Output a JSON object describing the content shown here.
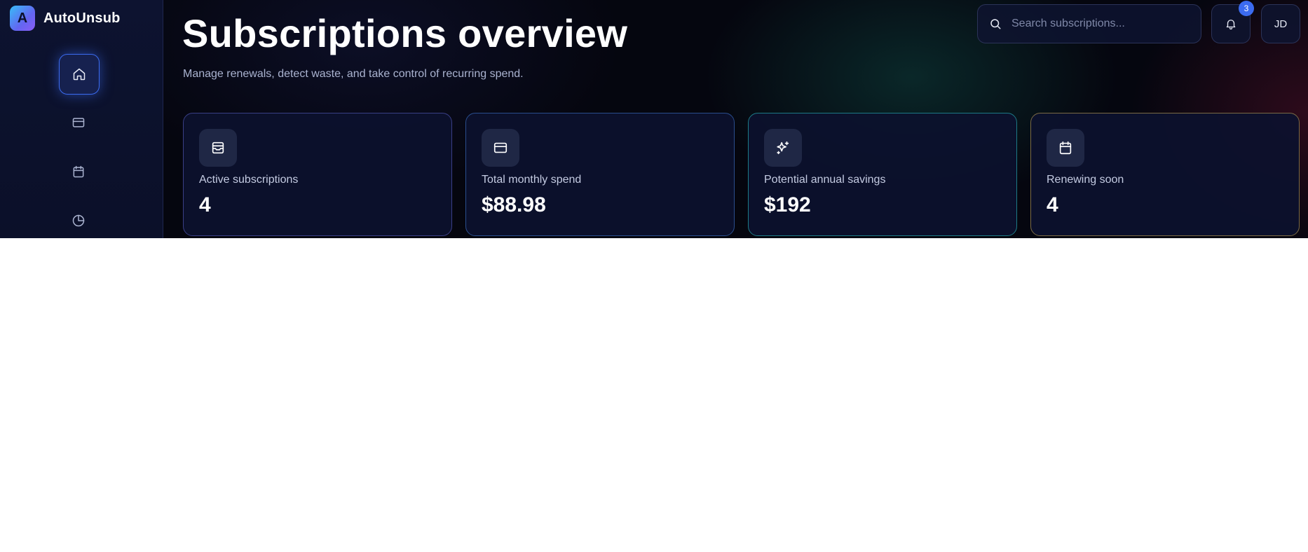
{
  "app": {
    "logo_letter": "A",
    "name": "AutoUnsub"
  },
  "sidebar": {
    "items": [
      {
        "icon": "home-icon",
        "active": true
      },
      {
        "icon": "credit-card-icon",
        "active": false
      },
      {
        "icon": "calendar-icon",
        "active": false
      },
      {
        "icon": "pie-chart-icon",
        "active": false
      }
    ]
  },
  "header": {
    "title": "Subscriptions overview",
    "subtitle": "Manage renewals, detect waste, and take control of recurring spend.",
    "search_placeholder": "Search subscriptions...",
    "notifications_count": "3",
    "avatar_initials": "JD"
  },
  "cards": [
    {
      "icon": "inbox-icon",
      "label": "Active subscriptions",
      "value": "4",
      "border": "#3a3f86"
    },
    {
      "icon": "credit-card-icon",
      "label": "Total monthly spend",
      "value": "$88.98",
      "border": "#2a4e8e"
    },
    {
      "icon": "sparkles-icon",
      "label": "Potential annual savings",
      "value": "$192",
      "border": "#1d7a86"
    },
    {
      "icon": "calendar-icon",
      "label": "Renewing soon",
      "value": "4",
      "border": "#7a6a45"
    }
  ]
}
